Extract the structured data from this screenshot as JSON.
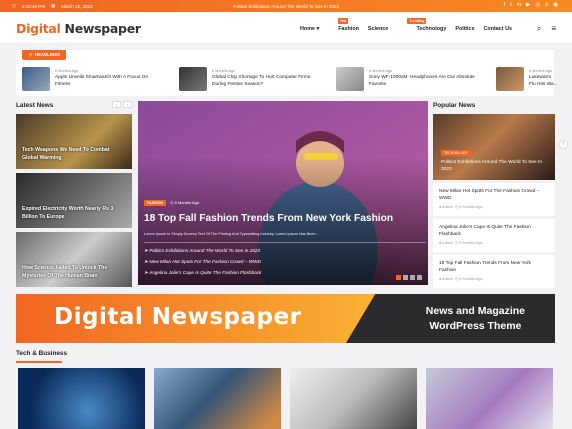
{
  "topbar": {
    "time": "8:19:46 PM",
    "date": "March 12, 2023",
    "ticker": "Politics Exhibitions Around The World To See In 2023",
    "social": [
      "f",
      "t",
      "in",
      "yt",
      "ig",
      "p",
      "rss"
    ]
  },
  "brand": {
    "logo_a": "Digital ",
    "logo_b": "Newspaper"
  },
  "nav": [
    {
      "label": "Home",
      "caret": true
    },
    {
      "label": "Fashion",
      "badge": "Hot"
    },
    {
      "label": "Science"
    },
    {
      "label": "Technology",
      "badge": "Trending"
    },
    {
      "label": "Politics"
    },
    {
      "label": "Contact Us"
    }
  ],
  "icons": {
    "search": "search-icon",
    "menu": "menu-icon"
  },
  "headlines": {
    "label": "HEADLINES",
    "items": [
      {
        "meta": "6 Months Ago",
        "title": "Apple Unveils Smartwatch With A Focus On Fitness"
      },
      {
        "meta": "6 Months Ago",
        "title": "Global Chip Shortage To Hurt Computer Firms During Festive Season?"
      },
      {
        "meta": "6 Months Ago",
        "title": "Sony WF-1000xM: Headphones Are Our Absolute Favorite"
      },
      {
        "meta": "6 Months Ago",
        "title": "Lukewarm Flu Hits Wa..."
      }
    ]
  },
  "latest": {
    "title": "Latest News",
    "items": [
      {
        "title": "Tech Weapons We Need To Combat Global Warming"
      },
      {
        "title": "Expired Electricity Worth Nearly Rs 3 Billion To Europe"
      },
      {
        "title": "How Science Failed To Unlock The Mysteries Of The Human Brain"
      }
    ]
  },
  "hero": {
    "category": "FASHION",
    "time": "6 Months Ago",
    "title": "18 Top Fall Fashion Trends From New York Fashion",
    "excerpt": "Lorem Ipsum Is Simply Dummy Text Of The Printing And Typesetting Industry. Lorem Ipsum Has Been...",
    "links": [
      "Politics Exhibitions Around The World To See In 2023",
      "New Milan Hot Spots For The Fashion Crowd – WWD",
      "Angelina Jolie's Cape Is Quite The Fashion Flashback"
    ]
  },
  "popular": {
    "title": "Popular News",
    "feature": {
      "category": "TECHNOLOGY",
      "title": "Politics Exhibitions Around The World To See In 2023"
    },
    "items": [
      {
        "title": "New Milan Hot Spots For The Fashion Crowd – WWD",
        "author": "Admin",
        "time": "6 Months Ago"
      },
      {
        "title": "Angelina Jolie's Cape Is Quite The Fashion Flashback",
        "author": "Admin",
        "time": "6 Months Ago"
      },
      {
        "title": "18 Top Fall Fashion Trends From New York Fashion",
        "author": "Admin",
        "time": "6 Months Ago"
      }
    ]
  },
  "banner": {
    "logo": "Digital Newspaper",
    "line1": "News and Magazine",
    "line2": "WordPress Theme"
  },
  "tech": {
    "title": "Tech & Business"
  },
  "colors": {
    "accent": "#f26522",
    "dark": "#2b2b2d"
  }
}
